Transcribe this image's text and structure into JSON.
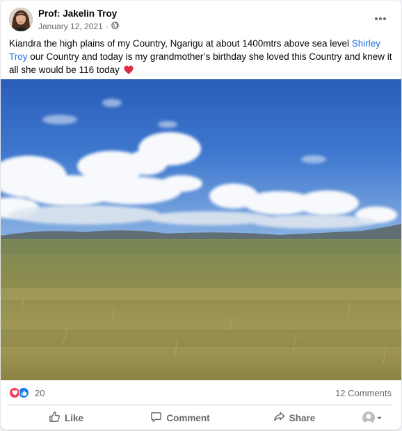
{
  "post": {
    "author": "Prof: Jakelin Troy",
    "date": "January 12, 2021",
    "privacy_icon": "globe-icon",
    "text_before_link": "Kiandra the high plains of my Country, Ngarigu at about 1400mtrs above sea level ",
    "link_text": "Shirley Troy",
    "text_after_link": " our Country and today is my grandmother’s birthday she loved this Country and knew it all she would be 116 today",
    "emoji": "red-heart-icon"
  },
  "engagement": {
    "reaction_icons": [
      "love-reaction-icon",
      "like-reaction-icon"
    ],
    "reaction_count": "20",
    "comment_count": "12 Comments"
  },
  "actions": {
    "like": "Like",
    "comment": "Comment",
    "share": "Share"
  },
  "colors": {
    "link": "#216fdb",
    "secondary_text": "#65676b",
    "love": "#f33e58",
    "like": "#1877f2"
  }
}
